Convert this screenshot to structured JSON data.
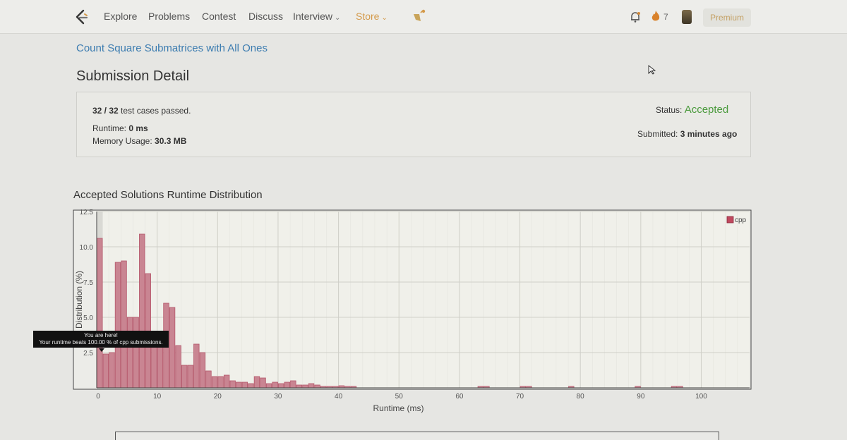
{
  "nav": {
    "links": [
      {
        "label": "Explore"
      },
      {
        "label": "Problems"
      },
      {
        "label": "Contest"
      },
      {
        "label": "Discuss"
      },
      {
        "label": "Interview"
      },
      {
        "label": "Store"
      }
    ],
    "streak": "7",
    "premium": "Premium",
    "store_color": "#d49a4a"
  },
  "problem": {
    "title": "Count Square Submatrices with All Ones"
  },
  "page_title": "Submission Detail",
  "summary": {
    "cases": "32 / 32",
    "cases_suffix": " test cases passed.",
    "runtime_label": "Runtime: ",
    "runtime": "0 ms",
    "memory_label": "Memory Usage: ",
    "memory": "30.3 MB",
    "status_label": "Status: ",
    "status": "Accepted",
    "status_color": "#4a9a3c",
    "submitted_label": "Submitted: ",
    "submitted": "3 minutes ago"
  },
  "chart_title": "Accepted Solutions Runtime Distribution",
  "tooltip": {
    "line1": "You are here!",
    "line2": "Your runtime beats 100.00 % of cpp submissions."
  },
  "chart_data": {
    "type": "bar",
    "xlabel": "Runtime (ms)",
    "ylabel": "Distribution (%)",
    "xlim": [
      0,
      108
    ],
    "ylim": [
      0,
      12.5
    ],
    "xticks": [
      0,
      10,
      20,
      30,
      40,
      50,
      60,
      70,
      80,
      90,
      100
    ],
    "yticks": [
      2.5,
      5.0,
      7.5,
      10.0,
      12.5
    ],
    "grid": true,
    "legend": "top-right",
    "series": [
      {
        "name": "cpp",
        "color": "#c98592",
        "x": [
          0,
          1,
          2,
          3,
          4,
          5,
          6,
          7,
          8,
          9,
          10,
          11,
          12,
          13,
          14,
          15,
          16,
          17,
          18,
          19,
          20,
          21,
          22,
          23,
          24,
          25,
          26,
          27,
          28,
          29,
          30,
          31,
          32,
          33,
          34,
          35,
          36,
          37,
          38,
          39,
          40,
          41,
          42,
          63,
          64,
          70,
          71,
          78,
          89,
          95,
          96
        ],
        "values": [
          10.6,
          2.4,
          2.5,
          8.9,
          9.0,
          5.0,
          5.0,
          10.9,
          8.1,
          3.2,
          3.2,
          6.0,
          5.7,
          3.0,
          1.6,
          1.6,
          3.1,
          2.5,
          1.2,
          0.8,
          0.8,
          0.9,
          0.5,
          0.4,
          0.4,
          0.3,
          0.8,
          0.7,
          0.3,
          0.4,
          0.3,
          0.4,
          0.5,
          0.2,
          0.2,
          0.3,
          0.2,
          0.1,
          0.1,
          0.1,
          0.15,
          0.1,
          0.1,
          0.1,
          0.1,
          0.1,
          0.1,
          0.1,
          0.1,
          0.1,
          0.1
        ]
      }
    ],
    "highlight": {
      "x": 0,
      "label": "You are here!"
    }
  }
}
